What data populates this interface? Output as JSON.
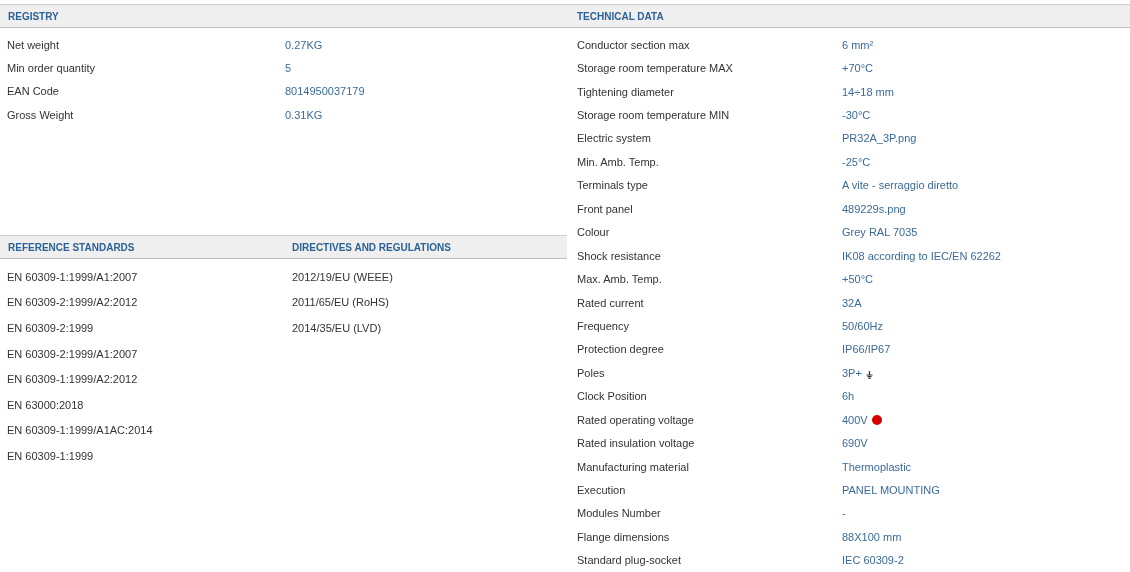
{
  "registry": {
    "title": "REGISTRY",
    "rows": [
      {
        "label": "Net weight",
        "value": "0.27KG"
      },
      {
        "label": "Min order quantity",
        "value": "5"
      },
      {
        "label": "EAN Code",
        "value": "8014950037179"
      },
      {
        "label": "Gross Weight",
        "value": "0.31KG"
      }
    ]
  },
  "reference_standards": {
    "title": "REFERENCE STANDARDS",
    "items": [
      "EN 60309-1:1999/A1:2007",
      "EN 60309-2:1999/A2:2012",
      "EN 60309-2:1999",
      "EN 60309-2:1999/A1:2007",
      "EN 60309-1:1999/A2:2012",
      "EN 63000:2018",
      "EN 60309-1:1999/A1AC:2014",
      "EN 60309-1:1999"
    ]
  },
  "directives": {
    "title": "DIRECTIVES AND REGULATIONS",
    "items": [
      "2012/19/EU (WEEE)",
      "2011/65/EU (RoHS)",
      "2014/35/EU (LVD)"
    ]
  },
  "technical_data": {
    "title": "TECHNICAL DATA",
    "rows": [
      {
        "kind": "text",
        "label": "Conductor section max",
        "value": "6 mm²"
      },
      {
        "kind": "text",
        "label": "Storage room temperature MAX",
        "value": "+70°C"
      },
      {
        "kind": "text",
        "label": "Tightening diameter",
        "value": "14÷18 mm"
      },
      {
        "kind": "text",
        "label": "Storage room temperature MIN",
        "value": "-30°C"
      },
      {
        "kind": "text",
        "label": "Electric system",
        "value": "PR32A_3P.png"
      },
      {
        "kind": "text",
        "label": "Min. Amb. Temp.",
        "value": "-25°C"
      },
      {
        "kind": "text",
        "label": "Terminals type",
        "value": "A vite - serraggio diretto"
      },
      {
        "kind": "text",
        "label": "Front panel",
        "value": "489229s.png"
      },
      {
        "kind": "text",
        "label": "Colour",
        "value": "Grey RAL 7035"
      },
      {
        "kind": "text",
        "label": "Shock resistance",
        "value": "IK08 according to IEC/EN 62262"
      },
      {
        "kind": "text",
        "label": "Max. Amb. Temp.",
        "value": "+50°C"
      },
      {
        "kind": "text",
        "label": "Rated current",
        "value": "32A"
      },
      {
        "kind": "text",
        "label": "Frequency",
        "value": "50/60Hz"
      },
      {
        "kind": "text",
        "label": "Protection degree",
        "value": "IP66/IP67"
      },
      {
        "kind": "earth",
        "label": "Poles",
        "value": "3P+"
      },
      {
        "kind": "text",
        "label": "Clock Position",
        "value": "6h"
      },
      {
        "kind": "dot",
        "label": "Rated operating voltage",
        "value": "400V",
        "color": "#d40000"
      },
      {
        "kind": "text",
        "label": "Rated insulation voltage",
        "value": "690V"
      },
      {
        "kind": "text",
        "label": "Manufacturing material",
        "value": "Thermoplastic"
      },
      {
        "kind": "text",
        "label": "Execution",
        "value": "PANEL MOUNTING"
      },
      {
        "kind": "text",
        "label": "Modules Number",
        "value": "-"
      },
      {
        "kind": "text",
        "label": "Flange dimensions",
        "value": "88X100 mm"
      },
      {
        "kind": "text",
        "label": "Standard plug-socket",
        "value": "IEC 60309-2"
      }
    ]
  }
}
